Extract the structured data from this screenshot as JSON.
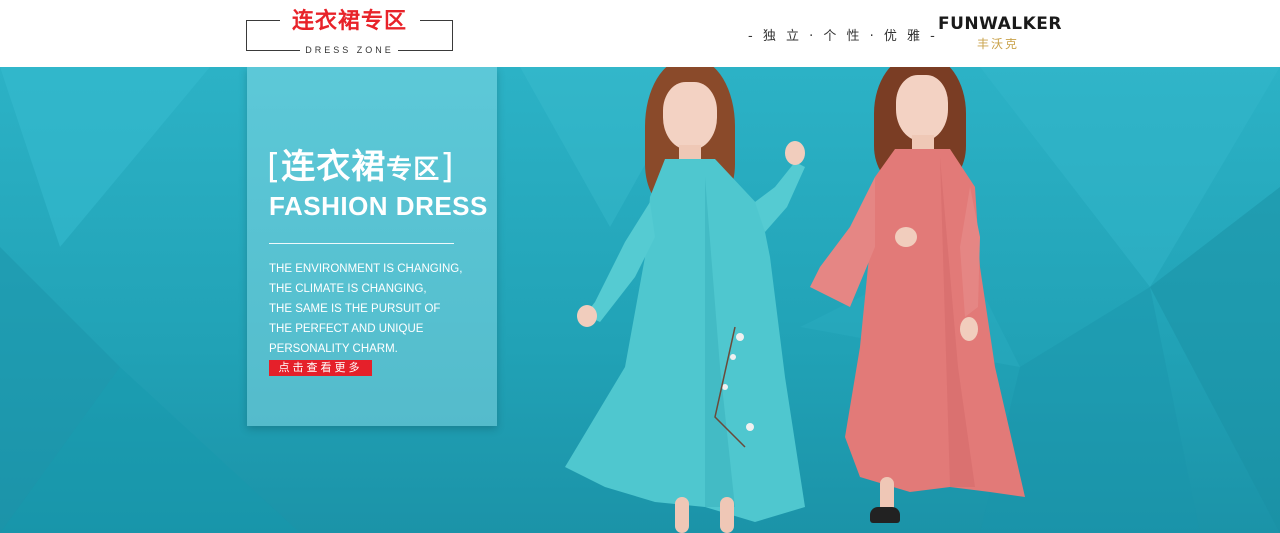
{
  "header": {
    "zone_title": "连衣裙专区",
    "zone_subtitle": "DRESS ZONE",
    "slogan": "- 独 立 · 个 性 · 优 雅 -",
    "brand_name": "FUNWALKER",
    "brand_cn": "丰沃克"
  },
  "panel": {
    "title_bracket_open": "[",
    "title_main": "连衣裙",
    "title_small": "专区",
    "title_bracket_close": "]",
    "title_en": "FASHION DRESS",
    "lines": [
      "THE ENVIRONMENT IS CHANGING,",
      "THE CLIMATE IS CHANGING,",
      "THE SAME IS THE PURSUIT OF",
      "THE PERFECT AND UNIQUE",
      "PERSONALITY CHARM."
    ],
    "cta_label": "点击查看更多"
  },
  "colors": {
    "accent_red": "#e5202a",
    "banner_teal": "#21a2b6",
    "brand_gold": "#c9a24a",
    "dress_teal": "#4fc7cf",
    "dress_coral": "#e27a78"
  }
}
